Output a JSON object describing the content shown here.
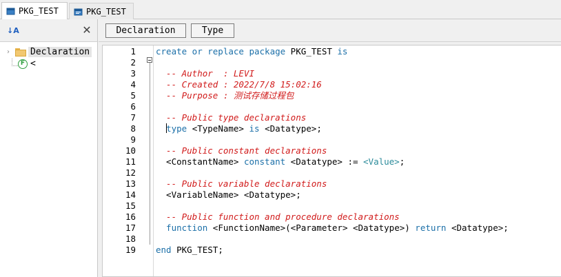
{
  "tabs": [
    {
      "label": "PKG_TEST",
      "active": true
    },
    {
      "label": "PKG_TEST",
      "active": false
    }
  ],
  "tree": {
    "root_label": "Declaration",
    "child_label": "<",
    "child_icon_letter": "F"
  },
  "toolbar": {
    "declaration_label": "Declaration",
    "type_label": "Type",
    "close_glyph": "✕",
    "sort_glyph": "↓A"
  },
  "colors": {
    "keyword": "#1b6fa8",
    "comment": "#d11b1b",
    "value": "#2a8a9a",
    "folder": "#f2c871",
    "function_icon": "#2e9e3e"
  },
  "editor": {
    "lines": [
      {
        "num": "1",
        "tokens": [
          {
            "t": "kw",
            "v": "create or replace package "
          },
          {
            "t": "id",
            "v": "PKG_TEST "
          },
          {
            "t": "kw",
            "v": "is"
          }
        ]
      },
      {
        "num": "2",
        "tokens": []
      },
      {
        "num": "3",
        "tokens": [
          {
            "t": "cm",
            "v": "  -- Author  : LEVI"
          }
        ]
      },
      {
        "num": "4",
        "tokens": [
          {
            "t": "cm",
            "v": "  -- Created : 2022/7/8 15:02:16"
          }
        ]
      },
      {
        "num": "5",
        "tokens": [
          {
            "t": "cm",
            "v": "  -- Purpose : 测试存储过程包"
          }
        ]
      },
      {
        "num": "6",
        "tokens": []
      },
      {
        "num": "7",
        "tokens": [
          {
            "t": "cm",
            "v": "  -- Public type declarations"
          }
        ]
      },
      {
        "num": "8",
        "tokens": [
          {
            "t": "id",
            "v": "  "
          },
          {
            "t": "caret",
            "v": ""
          },
          {
            "t": "kw",
            "v": "type "
          },
          {
            "t": "id",
            "v": "<TypeName> "
          },
          {
            "t": "kw",
            "v": "is "
          },
          {
            "t": "id",
            "v": "<Datatype>;"
          }
        ]
      },
      {
        "num": "9",
        "tokens": []
      },
      {
        "num": "10",
        "tokens": [
          {
            "t": "cm",
            "v": "  -- Public constant declarations"
          }
        ]
      },
      {
        "num": "11",
        "tokens": [
          {
            "t": "id",
            "v": "  <ConstantName> "
          },
          {
            "t": "kw",
            "v": "constant "
          },
          {
            "t": "id",
            "v": "<Datatype> := "
          },
          {
            "t": "val",
            "v": "<Value>"
          },
          {
            "t": "id",
            "v": ";"
          }
        ]
      },
      {
        "num": "12",
        "tokens": []
      },
      {
        "num": "13",
        "tokens": [
          {
            "t": "cm",
            "v": "  -- Public variable declarations"
          }
        ]
      },
      {
        "num": "14",
        "tokens": [
          {
            "t": "id",
            "v": "  <VariableName> <Datatype>;"
          }
        ]
      },
      {
        "num": "15",
        "tokens": []
      },
      {
        "num": "16",
        "tokens": [
          {
            "t": "cm",
            "v": "  -- Public function and procedure declarations"
          }
        ]
      },
      {
        "num": "17",
        "tokens": [
          {
            "t": "kw",
            "v": "  function "
          },
          {
            "t": "id",
            "v": "<FunctionName>(<Parameter> <Datatype>) "
          },
          {
            "t": "kw",
            "v": "return "
          },
          {
            "t": "id",
            "v": "<Datatype>;"
          }
        ]
      },
      {
        "num": "18",
        "tokens": []
      },
      {
        "num": "19",
        "tokens": [
          {
            "t": "kw",
            "v": "end "
          },
          {
            "t": "id",
            "v": "PKG_TEST;"
          }
        ]
      }
    ]
  }
}
